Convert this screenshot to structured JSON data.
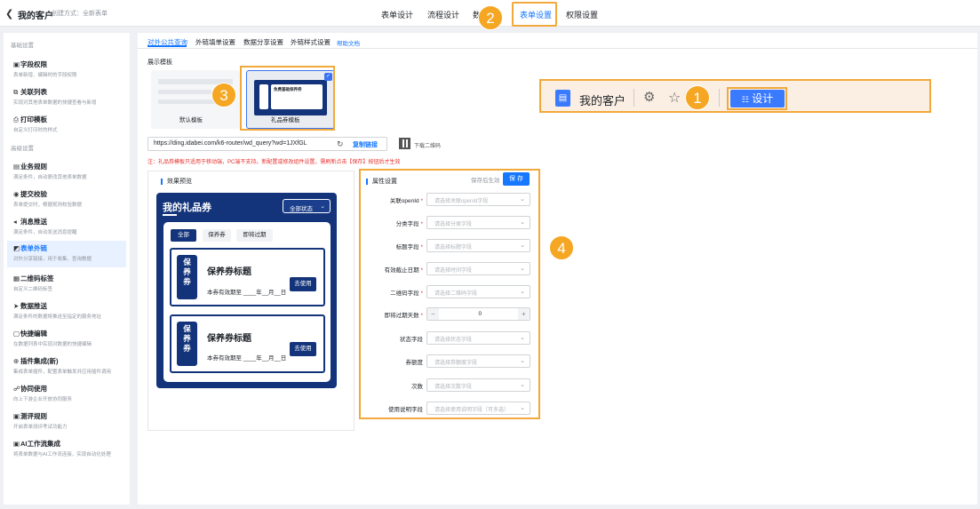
{
  "topbar": {
    "back_icon": "chevron-left-icon",
    "title": "我的客户",
    "subtitle": "创建方式：全新表单",
    "nav": [
      "表单设计",
      "流程设计",
      "数",
      "表单设置",
      "权限设置"
    ]
  },
  "badges": [
    "1",
    "2",
    "3",
    "4"
  ],
  "sidebar": {
    "section1": "基础设置",
    "section2": "高级设置",
    "items": [
      {
        "icon": "▣",
        "name": "字段权限",
        "desc": "表单新增、编辑时的字段权限"
      },
      {
        "icon": "⧉",
        "name": "关联列表",
        "desc": "实现对其他表单数据的快捷查看与新增"
      },
      {
        "icon": "⎙",
        "name": "打印模板",
        "desc": "自定义打印时的样式"
      },
      {
        "icon": "▤",
        "name": "业务规则",
        "desc": "满足条件，自动更改其他表单数据"
      },
      {
        "icon": "◉",
        "name": "提交校验",
        "desc": "表单提交时，根据规则校验数据"
      },
      {
        "icon": "◂",
        "name": "消息推送",
        "desc": "满足条件，自动发送消息提醒"
      },
      {
        "icon": "◩",
        "name": "表单外链",
        "desc": "对外分享链接，用于收集、查询数据"
      },
      {
        "icon": "▦",
        "name": "二维码标签",
        "desc": "自定义二维码标签"
      },
      {
        "icon": "➤",
        "name": "数据推送",
        "desc": "满足条件的数据将推送至指定的服务地址"
      },
      {
        "icon": "▢",
        "name": "快捷编辑",
        "desc": "在数据列表中实现对数据的快捷编辑"
      },
      {
        "icon": "⊕",
        "name": "插件集成(新)",
        "desc": "集成表单插件，配置表单触发并应用插件调用"
      },
      {
        "icon": "☍",
        "name": "协同使用",
        "desc": "向上下游企业开放协同服务"
      },
      {
        "icon": "▣",
        "name": "测评规则",
        "desc": "开启表单测评考试功能力"
      },
      {
        "icon": "▣",
        "name": "AI工作流集成",
        "desc": "将表单数据与AI工作流连接，实现自动化处理"
      }
    ]
  },
  "tabs": [
    "对外公共查询",
    "外链填单设置",
    "数据分享设置",
    "外链样式设置"
  ],
  "help_doc": "帮助文档",
  "template_section": "展示模板",
  "templates": {
    "default": "默认模板",
    "gift": "礼品券模板",
    "thumb_title": "免费基础保养券"
  },
  "url": {
    "value": "https://ding.idabei.com/k6-router/wd_query?wd=1JXfGL",
    "copy": "复制链接",
    "qr": "下载二维码"
  },
  "warning": "注：礼品券模板只适用于移动端，PC端不支持。新配置或修改组件设置，需刷新点击【保存】按钮后才生效",
  "preview": {
    "title": "效果预览",
    "phone_title": "我的礼品券",
    "status_select": "全部状态",
    "tabs": [
      "全部",
      "保养券",
      "即将过期"
    ],
    "coupons": [
      {
        "side": [
          "保",
          "养",
          "券"
        ],
        "title": "保养券标题",
        "valid": "本券有效期至 ____年__月__日",
        "btn": "去使用"
      },
      {
        "side": [
          "保",
          "养",
          "券"
        ],
        "title": "保养券标题",
        "valid": "本券有效期至 ____年__月__日",
        "btn": "去使用"
      }
    ]
  },
  "attrs": {
    "title": "属性设置",
    "save_effect": "保存后生效",
    "save": "保 存",
    "fields": [
      {
        "label": "关联openId",
        "req": true,
        "placeholder": "请选择关联openId字段"
      },
      {
        "label": "分类字段",
        "req": true,
        "placeholder": "请选择分类字段"
      },
      {
        "label": "标题字段",
        "req": true,
        "placeholder": "请选择标题字段"
      },
      {
        "label": "有效截止日期",
        "req": true,
        "placeholder": "请选择时间字段"
      },
      {
        "label": "二维码字段",
        "req": true,
        "placeholder": "请选择二维码字段"
      },
      {
        "label": "即将过期天数",
        "req": true,
        "placeholder": ""
      },
      {
        "label": "状态字段",
        "req": false,
        "placeholder": "请选择状态字段"
      },
      {
        "label": "券额度",
        "req": false,
        "placeholder": "请选择券额度字段"
      },
      {
        "label": "次数",
        "req": false,
        "placeholder": "请选择次数字段"
      },
      {
        "label": "使用说明字段",
        "req": false,
        "placeholder": "请选择使用说明字段（可多选）"
      }
    ],
    "stepper_value": "0"
  },
  "toolbar": {
    "title": "我的客户",
    "design": "设计",
    "design_icon": "sliders-icon"
  }
}
